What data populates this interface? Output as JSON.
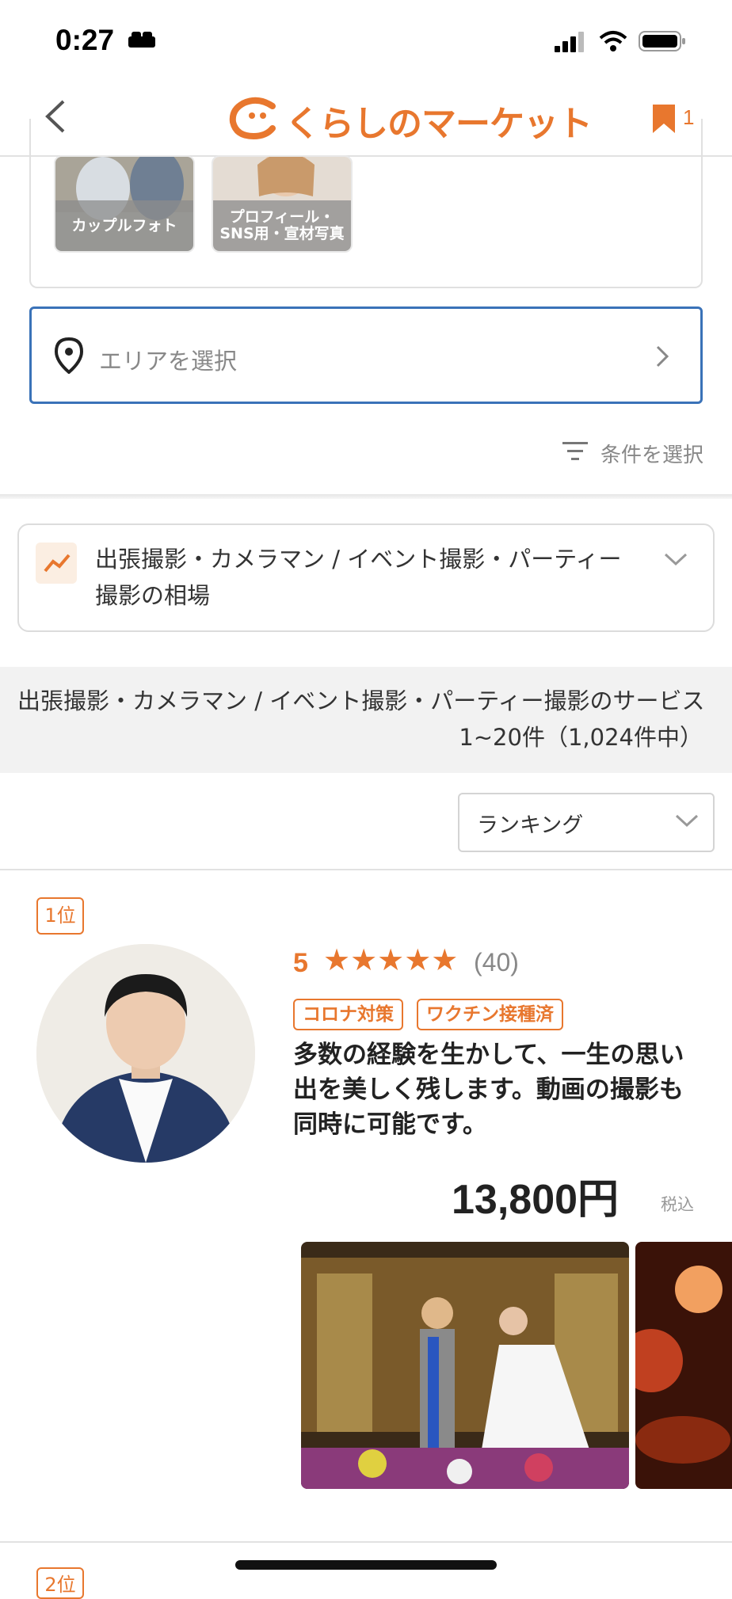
{
  "status_bar": {
    "time": "0:27"
  },
  "header": {
    "logo": "くらしのマーケット",
    "bookmark_count": "1"
  },
  "categories": [
    {
      "label": "カップルフォト"
    },
    {
      "label": "プロフィール・SNS用・宣材写真"
    }
  ],
  "area_select": {
    "placeholder": "エリアを選択"
  },
  "filter": {
    "label": "条件を選択"
  },
  "market_price": {
    "label": "出張撮影・カメラマン / イベント撮影・パーティー撮影の相場"
  },
  "list": {
    "title": "出張撮影・カメラマン / イベント撮影・パーティー撮影のサービス",
    "count": "1~20件（1,024件中）"
  },
  "sort": {
    "selected": "ランキング"
  },
  "items": [
    {
      "rank": "1位",
      "score": "5",
      "stars": "★★★★★",
      "reviews": "(40)",
      "tags": [
        "コロナ対策",
        "ワクチン接種済"
      ],
      "description": "多数の経験を生かして、一生の思い出を美しく残します。動画の撮影も同時に可能です。",
      "price": "13,800円",
      "tax": "税込"
    }
  ],
  "next_item": {
    "rank": "2位"
  },
  "colors": {
    "accent": "#e8772e",
    "link_blue": "#3a72b8"
  }
}
